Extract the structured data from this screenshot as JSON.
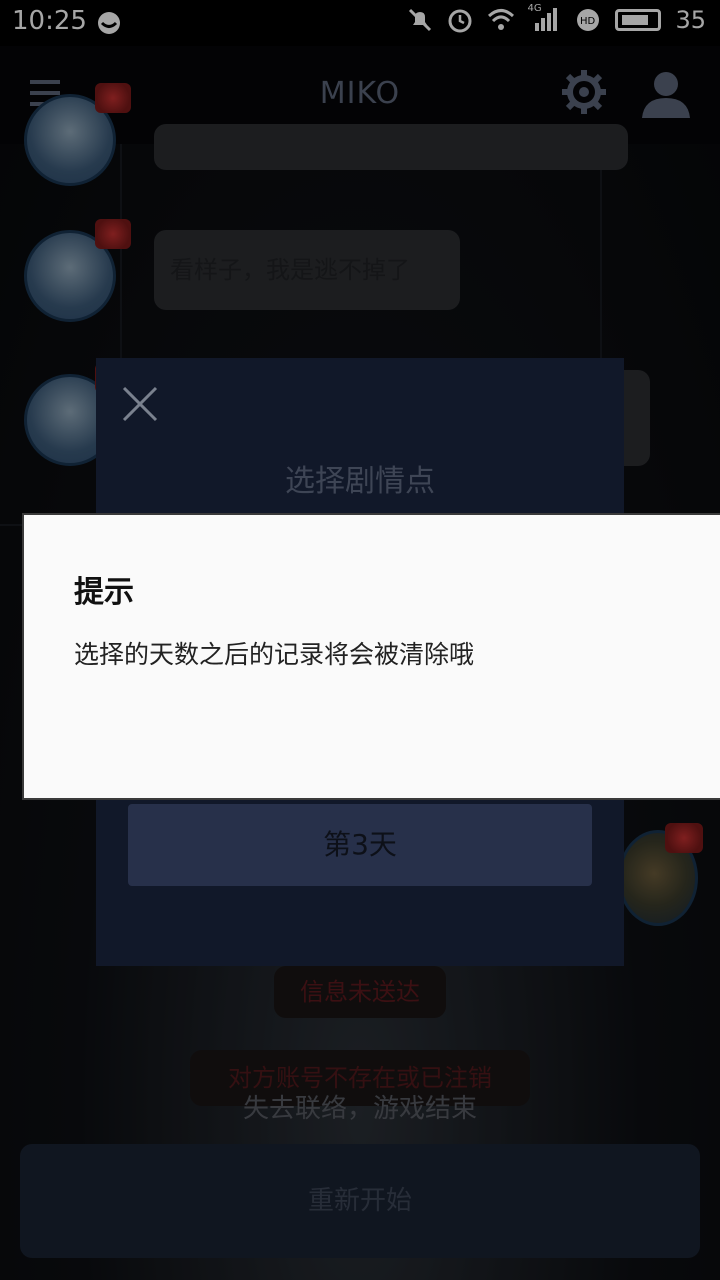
{
  "status_bar": {
    "time": "10:25",
    "battery": "35",
    "network": "4G"
  },
  "app_bar": {
    "title": "MIKO"
  },
  "chat": {
    "messages": [
      {
        "text": "看样子，我是逃不掉了"
      }
    ],
    "undelivered": "信息未送达",
    "notice": "对方账号不存在或已注销",
    "game_over": "失去联络，游戏结束",
    "restart_label": "重新开始"
  },
  "plot_dialog": {
    "title": "选择剧情点",
    "day_option": "第3天"
  },
  "alert": {
    "title": "提示",
    "message": "选择的天数之后的记录将会被清除哦"
  }
}
